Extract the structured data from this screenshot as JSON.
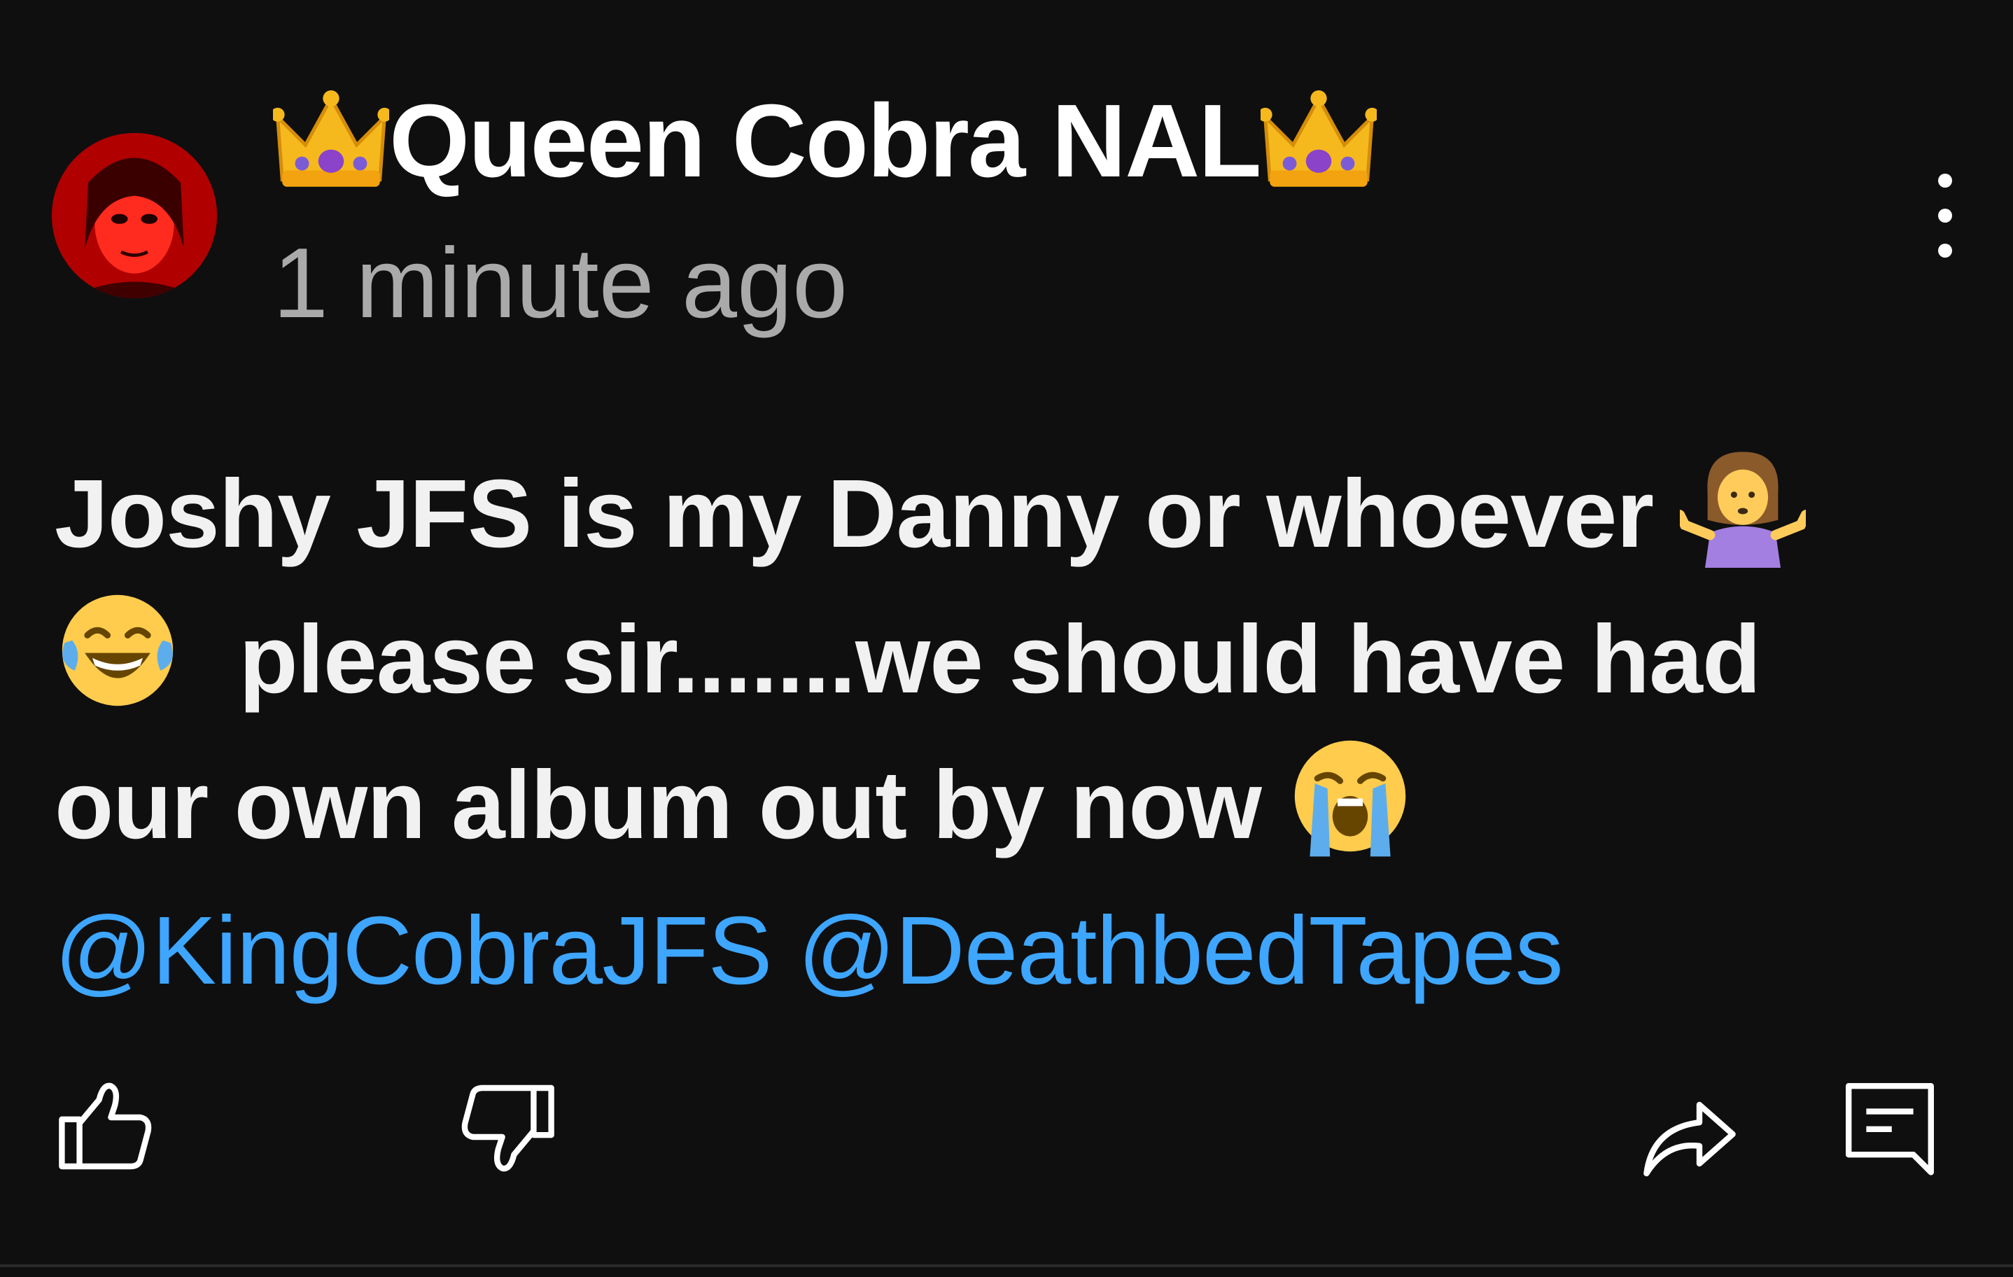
{
  "comment": {
    "author": "Queen Cobra NAL",
    "author_prefix_icon": "crown-emoji",
    "author_suffix_icon": "crown-emoji",
    "timestamp": "1 minute ago",
    "avatar_icon": "user-avatar",
    "menu_icon": "more-vertical-icon",
    "text_line1": "Joshy JFS is my Danny or whoever ",
    "text_line1_emoji": "woman-shrugging-emoji",
    "text_line2_emoji": "tears-of-joy-emoji",
    "text_line2": "please sir.......we should have had",
    "text_line3": "our own album out by now ",
    "text_line3_emoji": "loudly-crying-emoji",
    "mention1": "@KingCobraJFS",
    "mention2": "@DeathbedTapes"
  },
  "actions": {
    "like_icon": "thumbs-up-icon",
    "dislike_icon": "thumbs-down-icon",
    "share_icon": "share-icon",
    "reply_icon": "reply-icon"
  },
  "colors": {
    "background": "#0f0f10",
    "text": "#f1f1f1",
    "secondary_text": "#aaaaaa",
    "mention": "#3ea6ff"
  }
}
